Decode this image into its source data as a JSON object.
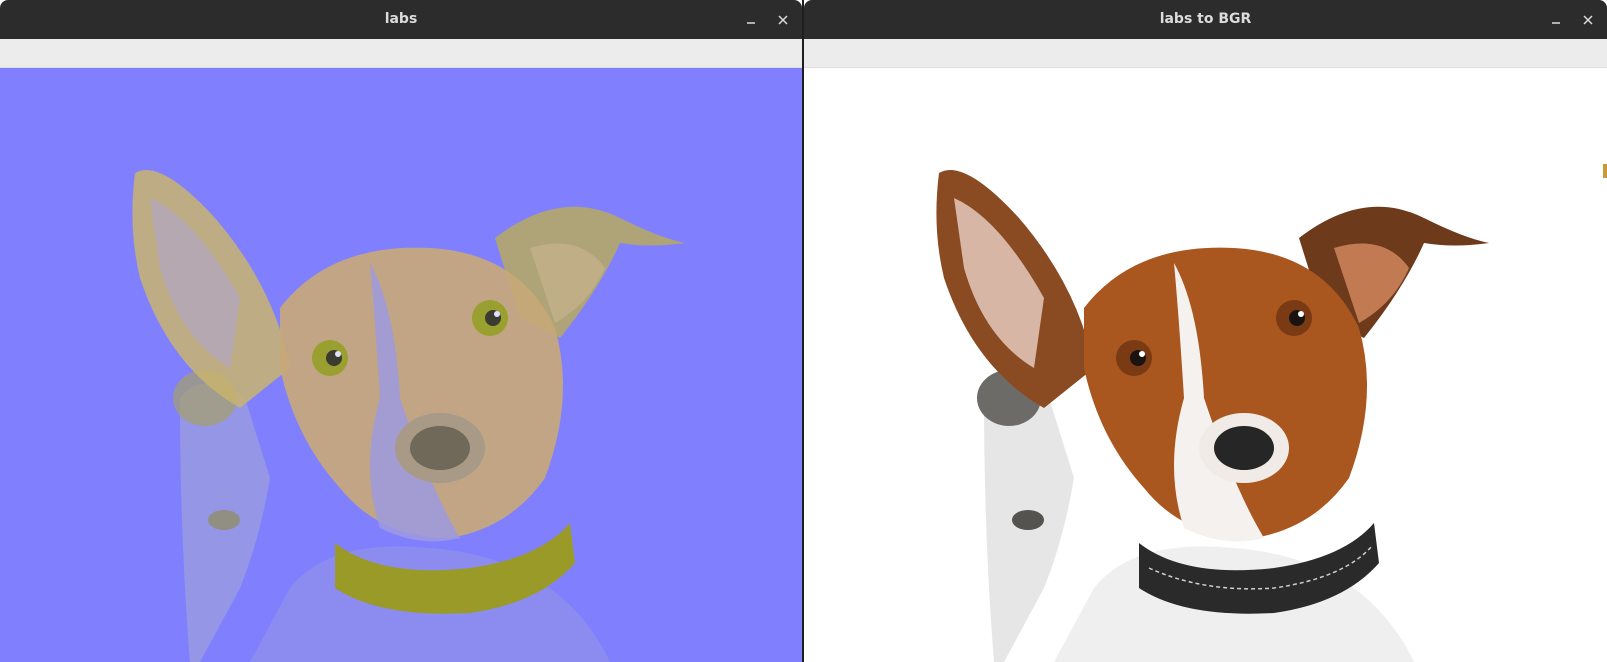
{
  "windows": [
    {
      "title": "labs",
      "minimize_icon": "minimize-icon",
      "close_icon": "close-icon"
    },
    {
      "title": "labs to BGR",
      "minimize_icon": "minimize-icon",
      "close_icon": "close-icon"
    }
  ],
  "colors": {
    "desktop": "#1e1e1e",
    "titlebar": "#2c2c2c",
    "title_text": "#dcdcdc",
    "toolbar": "#ececec",
    "lab_background": "#8080ff",
    "lab_fur": "#c8b46e",
    "lab_collar": "#9a9a28",
    "bgr_background": "#ffffff",
    "bgr_fur_brown": "#a9561f",
    "bgr_collar": "#2a2a2a"
  },
  "images": {
    "left": "dog-photo-lab-colorspace",
    "right": "dog-photo-bgr"
  }
}
